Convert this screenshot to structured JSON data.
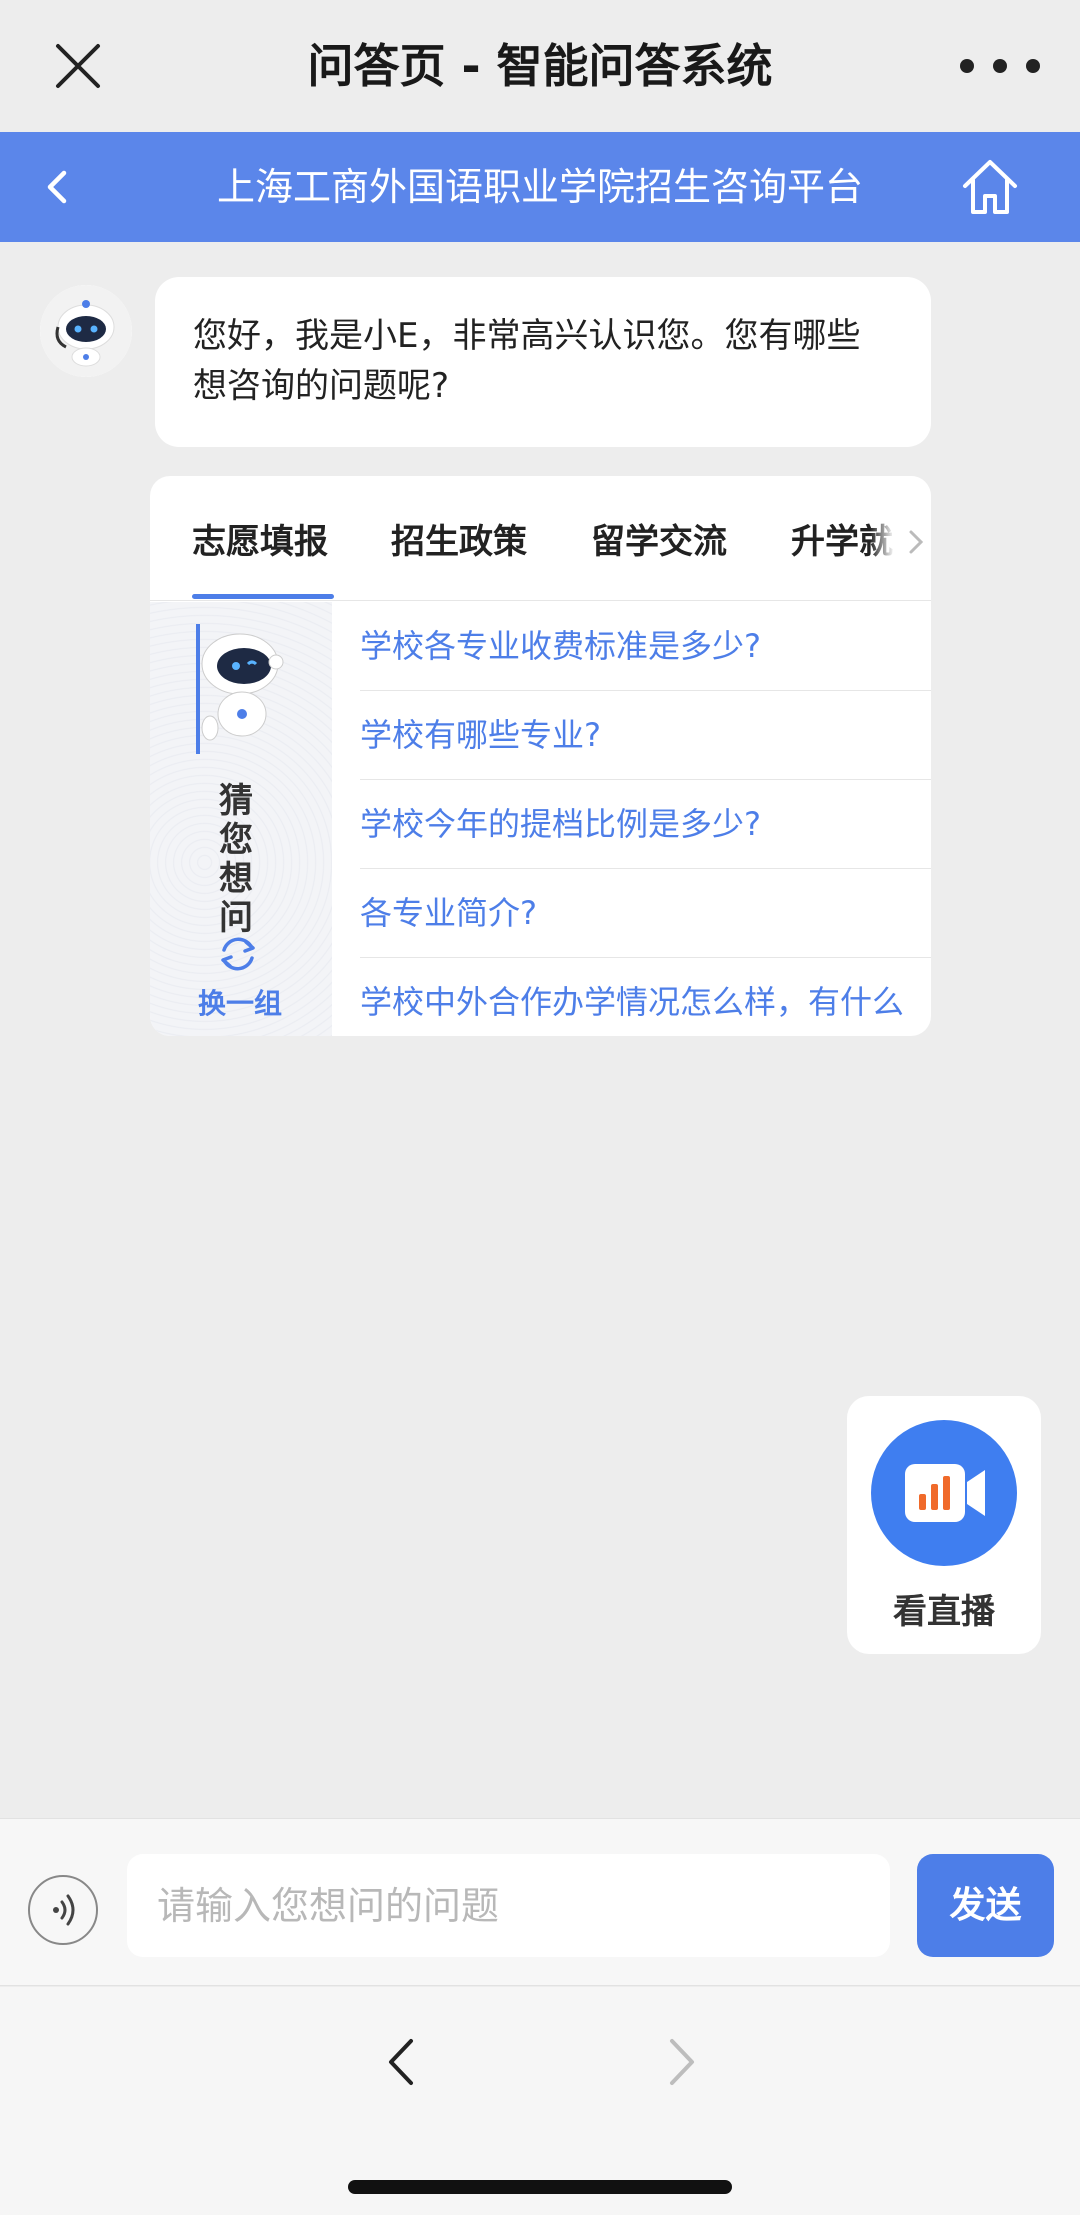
{
  "wechat_bar": {
    "title": "问答页 - 智能问答系统",
    "close_icon": "close-icon",
    "more_icon": "more-dots-icon"
  },
  "header": {
    "title": "上海工商外国语职业学院招生咨询平台",
    "back_icon": "chevron-left-icon",
    "home_icon": "home-icon",
    "color": "#5b86ea"
  },
  "chat": {
    "bot_message": "您好，我是小E，非常高兴认识您。您有哪些想咨询的问题呢?"
  },
  "suggestions": {
    "tabs": [
      {
        "label": "志愿填报",
        "active": true
      },
      {
        "label": "招生政策",
        "active": false
      },
      {
        "label": "留学交流",
        "active": false
      },
      {
        "label": "升学就",
        "active": false
      }
    ],
    "guess_label": "猜您想问",
    "refresh_label": "换一组",
    "questions": [
      "学校各专业收费标准是多少?",
      "学校有哪些专业?",
      "学校今年的提档比例是多少?",
      "各专业简介?",
      "学校中外合作办学情况怎么样，有什么"
    ]
  },
  "live": {
    "label": "看直播",
    "icon": "video-camera-icon",
    "bar_color": "#f06a2a"
  },
  "input": {
    "placeholder": "请输入您想问的问题",
    "value": "",
    "send_label": "发送",
    "voice_icon": "voice-icon"
  },
  "accent_color": "#4d7ee8"
}
